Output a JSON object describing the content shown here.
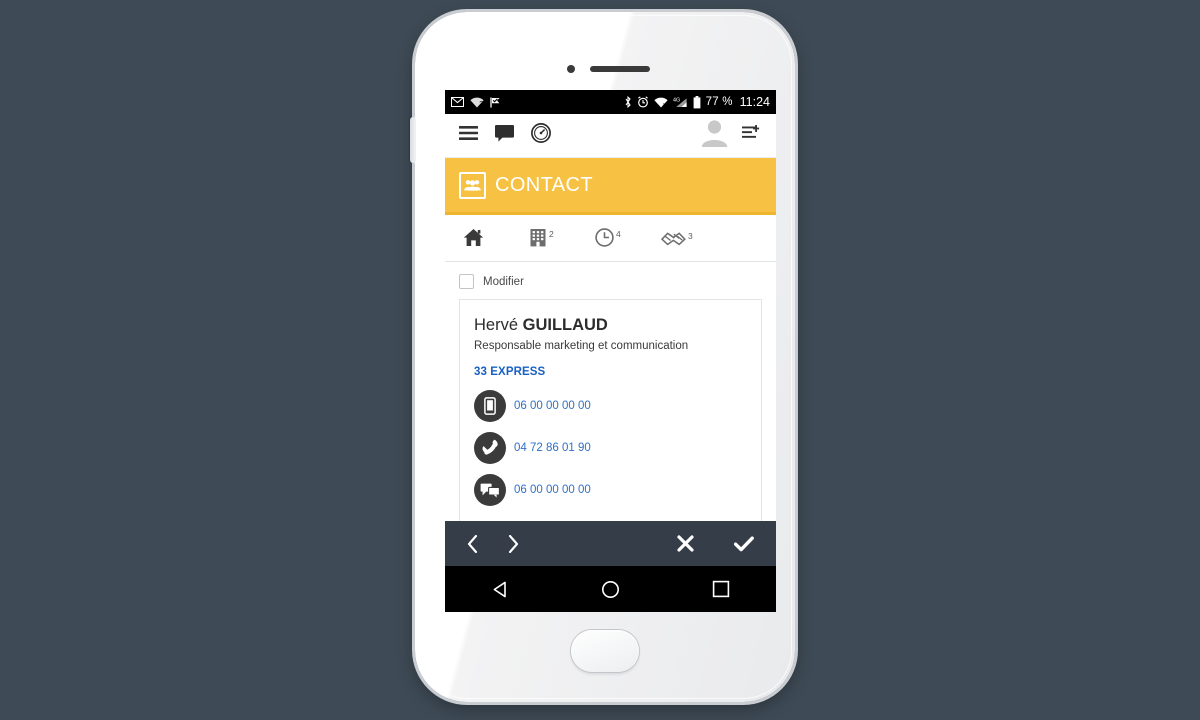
{
  "status_bar": {
    "left_icons": [
      "gmail-icon",
      "wifi-question-icon",
      "flag-check-icon"
    ],
    "right_icons": [
      "bluetooth-icon",
      "alarm-icon",
      "wifi-alert-icon",
      "signal-4g-icon",
      "battery-icon"
    ],
    "battery_text": "77 %",
    "time": "11:24"
  },
  "app_bar": {
    "menu_icon": "hamburger-menu-icon",
    "messages_icon": "speech-bubble-icon",
    "dashboard_icon": "gauge-icon",
    "avatar_icon": "user-avatar-icon",
    "add_list_icon": "add-to-list-icon"
  },
  "contact_header": {
    "icon": "group-people-icon",
    "title": "CONTACT",
    "background_color": "#f7c243"
  },
  "tabs": [
    {
      "name": "home",
      "icon": "home-icon",
      "badge": "",
      "active": true
    },
    {
      "name": "company",
      "icon": "building-icon",
      "badge": "2",
      "active": false
    },
    {
      "name": "history",
      "icon": "clock-icon",
      "badge": "4",
      "active": false
    },
    {
      "name": "deals",
      "icon": "handshake-icon",
      "badge": "3",
      "active": false
    }
  ],
  "modifier": {
    "label": "Modifier",
    "checked": false
  },
  "contact_card": {
    "first_name": "Hervé",
    "last_name": "GUILLAUD",
    "role": "Responsable marketing et communication",
    "company": "33 EXPRESS",
    "company_color": "#1960c4",
    "rows": [
      {
        "icon": "mobile-phone-icon",
        "label": "mobile",
        "value": "06 00 00 00 00"
      },
      {
        "icon": "phone-handset-icon",
        "label": "landline",
        "value": "04 72 86 01 90"
      },
      {
        "icon": "sms-chat-icon",
        "label": "sms",
        "value": "06 00 00 00 00"
      }
    ]
  },
  "toolbar": {
    "prev_icon": "chevron-left-icon",
    "next_icon": "chevron-right-icon",
    "cancel_icon": "close-x-icon",
    "confirm_icon": "check-icon",
    "background_color": "#353e48"
  },
  "nav_bar": {
    "back_icon": "android-back-icon",
    "home_icon": "android-home-icon",
    "recents_icon": "android-recents-icon"
  }
}
